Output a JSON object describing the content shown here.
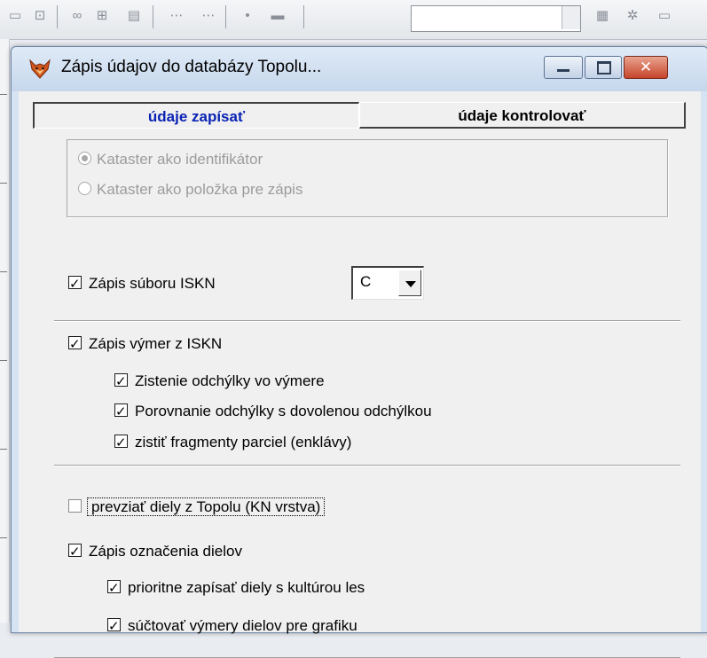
{
  "window": {
    "title": "Zápis údajov do databázy Topolu...",
    "close_glyph": "✕"
  },
  "tabs": [
    {
      "label": "údaje zapísať",
      "active": true
    },
    {
      "label": "údaje kontrolovať",
      "active": false
    }
  ],
  "kataster_group": {
    "options": [
      {
        "label": "Kataster ako identifikátor",
        "selected": true
      },
      {
        "label": "Kataster ako položka pre zápis",
        "selected": false
      }
    ]
  },
  "iskn_file": {
    "label": "Zápis súboru ISKN",
    "checked": true,
    "combo_value": "C"
  },
  "vymer": {
    "label": "Zápis výmer z ISKN",
    "checked": true,
    "sub": [
      {
        "label": "Zistenie odchýlky vo výmere",
        "checked": true
      },
      {
        "label": "Porovnanie odchýlky s dovolenou odchýlkou",
        "checked": true
      },
      {
        "label": "zistiť fragmenty parciel (enklávy)",
        "checked": true
      }
    ]
  },
  "prevziat": {
    "label": "prevziať diely z Topolu (KN vrstva)",
    "checked": false
  },
  "dielov": {
    "label": "Zápis označenia dielov",
    "checked": true,
    "sub": [
      {
        "label": "prioritne zapísať diely s kultúrou les",
        "checked": true
      },
      {
        "label": "súčtovať výmery dielov pre grafiku",
        "checked": true
      }
    ]
  },
  "colors": {
    "active_tab_text": "#0b24b3",
    "titlebar": "#d6e3f2",
    "close_button": "#c6452b"
  },
  "icons": [
    "fox-app-icon",
    "minimize-icon",
    "maximize-icon",
    "close-icon",
    "dropdown-arrow-icon"
  ]
}
